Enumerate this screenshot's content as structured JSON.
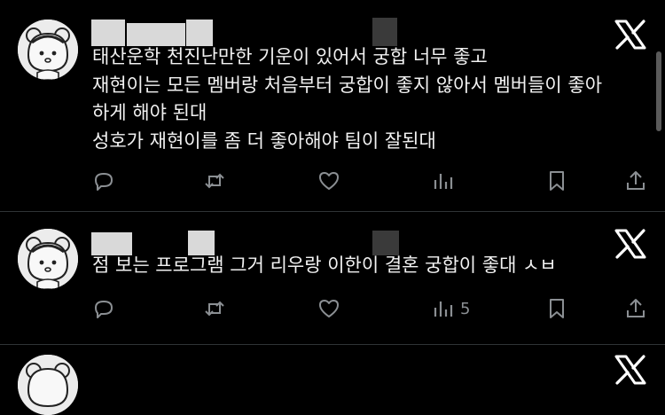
{
  "posts": [
    {
      "lines": [
        "태산운학 천진난만한 기운이 있어서 궁합 너무 좋고",
        "재현이는 모든 멤버랑 처음부터 궁합이 좋지 않아서 멤버들이 좋아",
        "하게 해야 된대",
        "성호가 재현이를 좀 더 좋아해야 팀이 잘된대"
      ],
      "views": ""
    },
    {
      "lines": [
        "점 보는 프로그램 그거 리우랑 이한이 결혼 궁합이 좋대 ㅅㅂ"
      ],
      "views": "5"
    }
  ],
  "icons": {
    "reply": "reply-icon",
    "repost": "repost-icon",
    "like": "heart-icon",
    "views": "views-icon",
    "bookmark": "bookmark-icon",
    "share": "share-icon",
    "logo": "x-logo-icon"
  },
  "colors": {
    "background": "#000000",
    "text": "#e7e9ea",
    "icon": "#8b8f93",
    "divider": "#2f3336"
  }
}
